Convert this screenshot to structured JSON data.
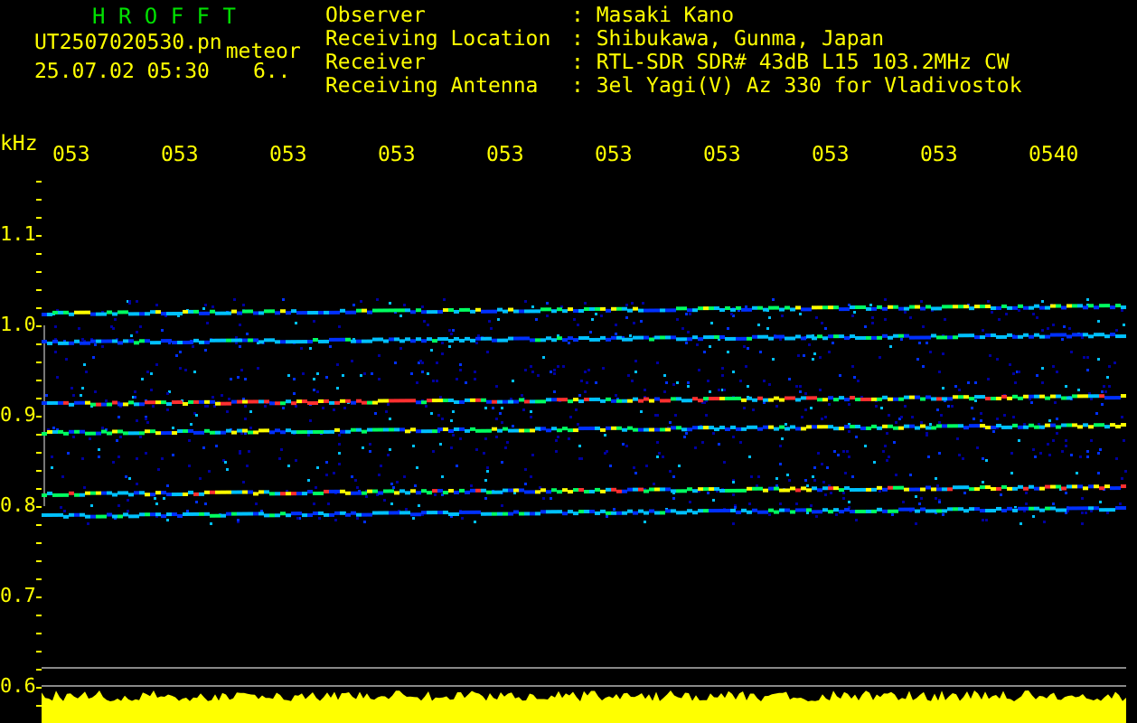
{
  "header": {
    "title": "H R O F F T",
    "file_name": "UT2507020530.pn",
    "file_suffix": "meteor",
    "datetime": "25.07.02 05:30",
    "count": "6.."
  },
  "info": [
    {
      "label": "Observer",
      "value": ": Masaki Kano"
    },
    {
      "label": "Receiving Location",
      "value": ": Shibukawa, Gunma, Japan"
    },
    {
      "label": "Receiver",
      "value": ": RTL-SDR SDR# 43dB L15 103.2MHz CW"
    },
    {
      "label": "Receiving Antenna",
      "value": ": 3el Yagi(V) Az 330 for Vladivostok"
    }
  ],
  "y_unit": "kHz",
  "time_ticks": [
    "053",
    "053",
    "053",
    "053",
    "053",
    "053",
    "053",
    "053",
    "053",
    "0540"
  ],
  "y_labels": [
    "1.1",
    "1.0",
    "0.9",
    "0.8",
    "0.7",
    "0.6"
  ]
}
